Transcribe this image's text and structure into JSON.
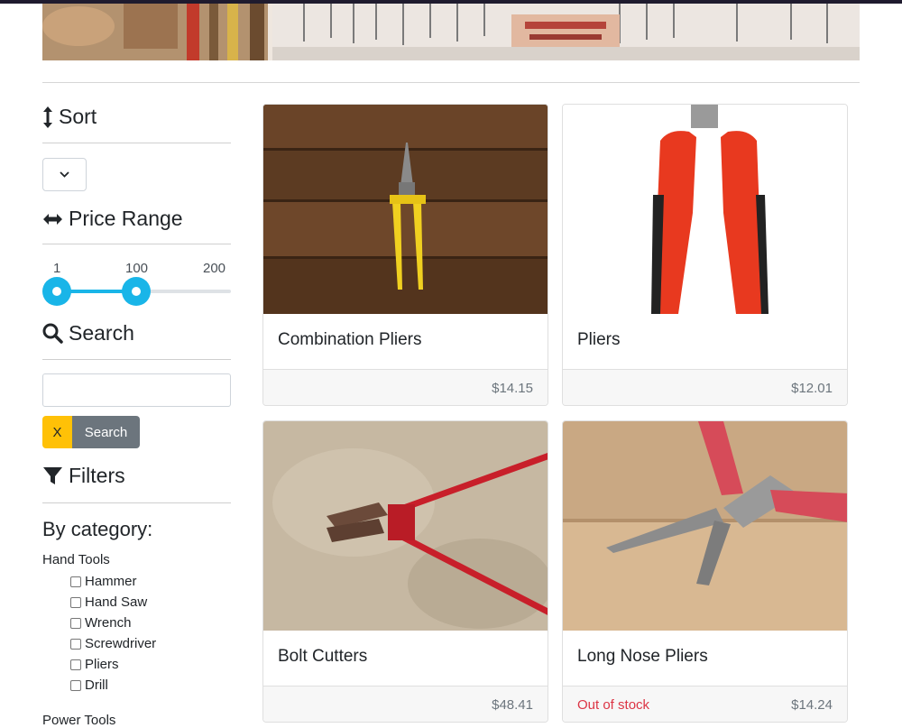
{
  "sidebar": {
    "sort_title": "Sort",
    "price_title": "Price Range",
    "price_min": "1",
    "price_current": "100",
    "price_max": "200",
    "search_title": "Search",
    "search_placeholder": "",
    "clear_label": "X",
    "search_label": "Search",
    "filters_title": "Filters",
    "by_category": "By category:",
    "groups": [
      {
        "label": "Hand Tools",
        "items": [
          "Hammer",
          "Hand Saw",
          "Wrench",
          "Screwdriver",
          "Pliers",
          "Drill"
        ]
      },
      {
        "label": "Power Tools",
        "items": []
      }
    ]
  },
  "products": [
    {
      "title": "Combination Pliers",
      "price": "$14.15",
      "status": ""
    },
    {
      "title": "Pliers",
      "price": "$12.01",
      "status": ""
    },
    {
      "title": "Bolt Cutters",
      "price": "$48.41",
      "status": ""
    },
    {
      "title": "Long Nose Pliers",
      "price": "$14.24",
      "status": "Out of stock"
    }
  ],
  "colors": {
    "accent": "#19b5e8",
    "warning": "#ffc107",
    "secondary": "#6c757d",
    "danger": "#dc3545"
  }
}
